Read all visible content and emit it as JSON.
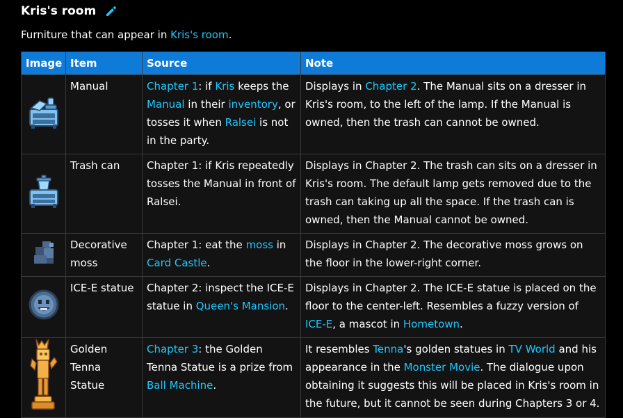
{
  "section": {
    "title": "Kris's room",
    "edit_icon": "pencil-icon",
    "intro_prefix": "Furniture that can appear in ",
    "intro_link": "Kris's room",
    "intro_suffix": "."
  },
  "colors": {
    "header_bg": "#0f7bd8",
    "link": "#1ec8ff",
    "row_bg": "#131313"
  },
  "table": {
    "headers": [
      "Image",
      "Item",
      "Source",
      "Note"
    ],
    "rows": [
      {
        "image": "manual-on-dresser-sprite",
        "item": "Manual",
        "source": [
          {
            "t": "Chapter 1",
            "l": true
          },
          {
            "t": ": if "
          },
          {
            "t": "Kris",
            "l": true
          },
          {
            "t": " keeps the "
          },
          {
            "t": "Manual",
            "l": true
          },
          {
            "t": " in their "
          },
          {
            "t": "inventory",
            "l": true
          },
          {
            "t": ", or tosses it when "
          },
          {
            "t": "Ralsei",
            "l": true
          },
          {
            "t": " is not in the party."
          }
        ],
        "note": [
          {
            "t": "Displays in "
          },
          {
            "t": "Chapter 2",
            "l": true
          },
          {
            "t": ". The Manual sits on a dresser in Kris's room, to the left of the lamp. If the Manual is owned, then the trash can cannot be owned."
          }
        ]
      },
      {
        "image": "trash-can-on-dresser-sprite",
        "item": "Trash can",
        "source": [
          {
            "t": "Chapter 1: if Kris repeatedly tosses the Manual in front of Ralsei."
          }
        ],
        "note": [
          {
            "t": "Displays in Chapter 2. The trash can sits on a dresser in Kris's room. The default lamp gets removed due to the trash can taking up all the space. If the trash can is owned, then the Manual cannot be owned."
          }
        ]
      },
      {
        "image": "decorative-moss-sprite",
        "item": "Decorative moss",
        "source": [
          {
            "t": "Chapter 1: eat the "
          },
          {
            "t": "moss",
            "l": true
          },
          {
            "t": " in "
          },
          {
            "t": "Card Castle",
            "l": true
          },
          {
            "t": "."
          }
        ],
        "note": [
          {
            "t": "Displays in Chapter 2. The decorative moss grows on the floor in the lower-right corner."
          }
        ]
      },
      {
        "image": "ice-e-statue-sprite",
        "item": "ICE-E statue",
        "source": [
          {
            "t": "Chapter 2: inspect the ICE-E statue in "
          },
          {
            "t": "Queen's Mansion",
            "l": true
          },
          {
            "t": "."
          }
        ],
        "note": [
          {
            "t": "Displays in Chapter 2. The ICE-E statue is placed on the floor to the center-left. Resembles a fuzzy version of "
          },
          {
            "t": "ICE-E",
            "l": true
          },
          {
            "t": ", a mascot in "
          },
          {
            "t": "Hometown",
            "l": true
          },
          {
            "t": "."
          }
        ]
      },
      {
        "image": "golden-tenna-statue-sprite",
        "item": "Golden Tenna Statue",
        "source": [
          {
            "t": "Chapter 3",
            "l": true
          },
          {
            "t": ": the Golden Tenna Statue is a prize from "
          },
          {
            "t": "Ball Machine",
            "l": true
          },
          {
            "t": "."
          }
        ],
        "note": [
          {
            "t": "It resembles "
          },
          {
            "t": "Tenna",
            "l": true
          },
          {
            "t": "'s golden statues in "
          },
          {
            "t": "TV World",
            "l": true
          },
          {
            "t": " and his appearance in the "
          },
          {
            "t": "Monster Movie",
            "l": true
          },
          {
            "t": ". The dialogue upon obtaining it suggests this will be placed in Kris's room in the future, but it cannot be seen during Chapters 3 or 4."
          }
        ]
      }
    ]
  }
}
